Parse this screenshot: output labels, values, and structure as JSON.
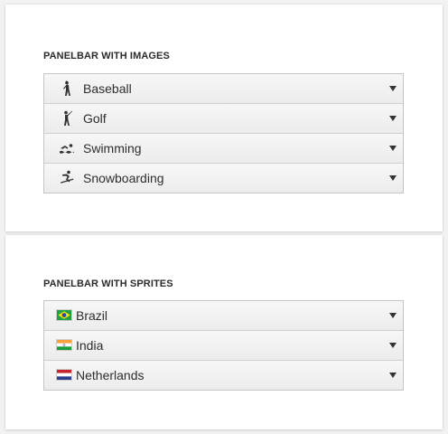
{
  "images_section": {
    "title": "PANELBAR WITH IMAGES",
    "items": [
      {
        "label": "Baseball",
        "icon": "baseball-player-icon"
      },
      {
        "label": "Golf",
        "icon": "golf-player-icon"
      },
      {
        "label": "Swimming",
        "icon": "swimmer-icon"
      },
      {
        "label": "Snowboarding",
        "icon": "snowboarder-icon"
      }
    ]
  },
  "sprites_section": {
    "title": "PANELBAR WITH SPRITES",
    "items": [
      {
        "label": "Brazil",
        "icon": "brazil-flag-icon"
      },
      {
        "label": "India",
        "icon": "india-flag-icon"
      },
      {
        "label": "Netherlands",
        "icon": "netherlands-flag-icon"
      }
    ]
  },
  "colors": {
    "text": "#2e2e2e",
    "border": "#c5c5c5",
    "arrow": "#333333"
  }
}
